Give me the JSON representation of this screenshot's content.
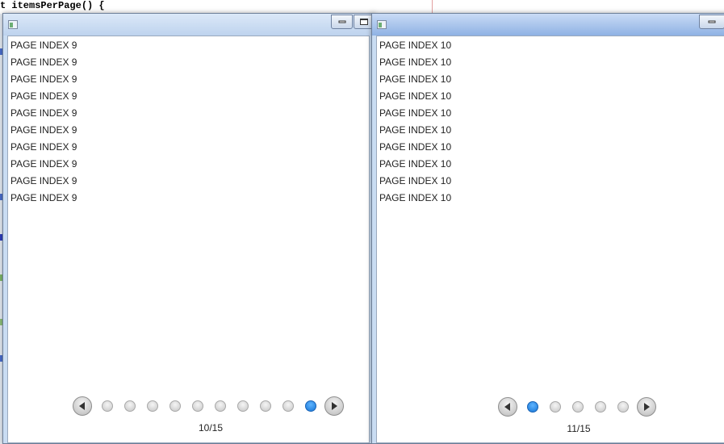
{
  "background_code": {
    "line": "t itemsPerPage() {"
  },
  "windows": [
    {
      "id": "left",
      "items": [
        "PAGE INDEX 9",
        "PAGE INDEX 9",
        "PAGE INDEX 9",
        "PAGE INDEX 9",
        "PAGE INDEX 9",
        "PAGE INDEX 9",
        "PAGE INDEX 9",
        "PAGE INDEX 9",
        "PAGE INDEX 9",
        "PAGE INDEX 9"
      ],
      "pager": {
        "indicators": 10,
        "active_indicator": 10,
        "label": "10/15"
      }
    },
    {
      "id": "right",
      "items": [
        "PAGE INDEX 10",
        "PAGE INDEX 10",
        "PAGE INDEX 10",
        "PAGE INDEX 10",
        "PAGE INDEX 10",
        "PAGE INDEX 10",
        "PAGE INDEX 10",
        "PAGE INDEX 10",
        "PAGE INDEX 10",
        "PAGE INDEX 10"
      ],
      "pager": {
        "indicators": 5,
        "active_indicator": 1,
        "label": "11/15"
      }
    }
  ],
  "icons": {
    "app": "app-window-icon",
    "minimize": "minimize-icon",
    "maximize": "maximize-icon",
    "prev": "chevron-left-icon",
    "next": "chevron-right-icon"
  },
  "colors": {
    "active_dot": "#1776d6",
    "window_frame": "#c9dcf2",
    "text": "#222222"
  }
}
